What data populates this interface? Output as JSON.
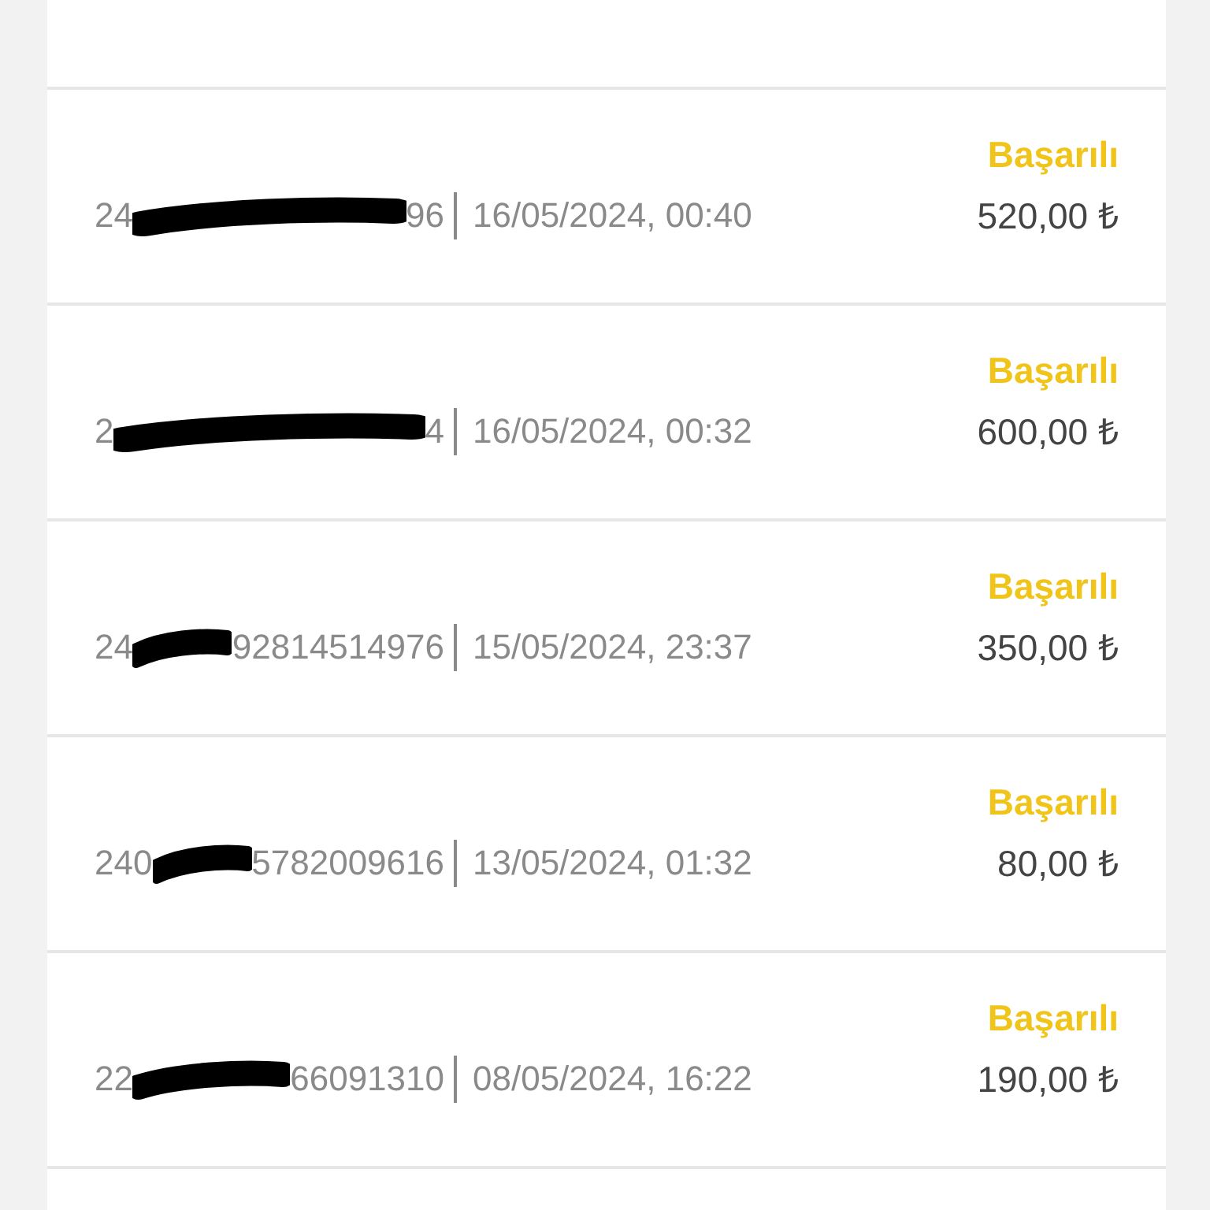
{
  "transactions": [
    {
      "id_start": "24",
      "id_end": "96",
      "date": "16/05/2024, 00:40",
      "status": "Başarılı",
      "amount": "520,00 ₺"
    },
    {
      "id_start": "2",
      "id_end": "4",
      "date": "16/05/2024, 00:32",
      "status": "Başarılı",
      "amount": "600,00 ₺"
    },
    {
      "id_start": "24",
      "id_end": "92814514976",
      "date": "15/05/2024, 23:37",
      "status": "Başarılı",
      "amount": "350,00 ₺"
    },
    {
      "id_start": "240",
      "id_end": "5782009616",
      "date": "13/05/2024, 01:32",
      "status": "Başarılı",
      "amount": "80,00 ₺"
    },
    {
      "id_start": "22",
      "id_end": "66091310",
      "date": "08/05/2024, 16:22",
      "status": "Başarılı",
      "amount": "190,00 ₺"
    }
  ]
}
